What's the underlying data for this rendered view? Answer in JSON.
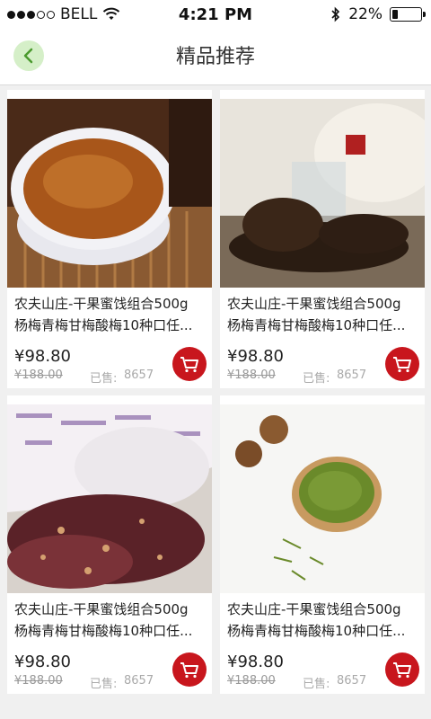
{
  "status_bar": {
    "carrier": "BELL",
    "time": "4:21 PM",
    "battery_percent": "22%",
    "battery_level": 0.22
  },
  "nav": {
    "title": "精品推荐"
  },
  "products": [
    {
      "title_line1": "农夫山庄-干果蜜饯组合500g",
      "title_line2": "杨梅青梅甘梅酸梅10种口任...",
      "price": "¥98.80",
      "old_price": "¥188.00",
      "sold_label": "已售:",
      "sold_count": "8657"
    },
    {
      "title_line1": "农夫山庄-干果蜜饯组合500g",
      "title_line2": "杨梅青梅甘梅酸梅10种口任...",
      "price": "¥98.80",
      "old_price": "¥188.00",
      "sold_label": "已售:",
      "sold_count": "8657"
    },
    {
      "title_line1": "农夫山庄-干果蜜饯组合500g",
      "title_line2": "杨梅青梅甘梅酸梅10种口任...",
      "price": "¥98.80",
      "old_price": "¥188.00",
      "sold_label": "已售:",
      "sold_count": "8657"
    },
    {
      "title_line1": "农夫山庄-干果蜜饯组合500g",
      "title_line2": "杨梅青梅甘梅酸梅10种口任...",
      "price": "¥98.80",
      "old_price": "¥188.00",
      "sold_label": "已售:",
      "sold_count": "8657"
    }
  ],
  "colors": {
    "cart_button": "#c8161d",
    "back_button": "#d5efc8",
    "back_arrow": "#4a9a2e"
  }
}
